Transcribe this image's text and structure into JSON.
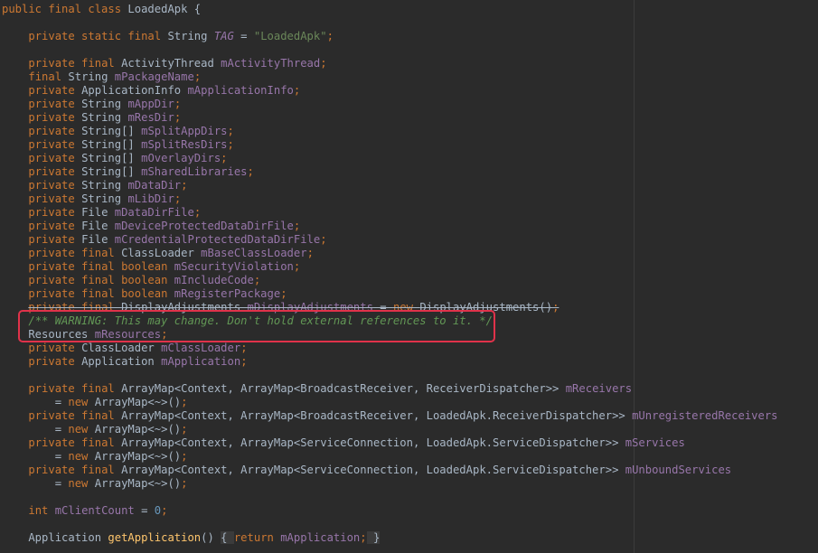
{
  "editor": {
    "lines": [
      [
        [
          "kw",
          "public final class "
        ],
        [
          "p",
          "LoadedApk {"
        ]
      ],
      [
        [
          "p",
          ""
        ]
      ],
      [
        [
          "p",
          "    "
        ],
        [
          "kw",
          "private static final "
        ],
        [
          "p",
          "String "
        ],
        [
          "const",
          "TAG"
        ],
        [
          "p",
          " = "
        ],
        [
          "str",
          "\"LoadedApk\""
        ],
        [
          "kw",
          ";"
        ]
      ],
      [
        [
          "p",
          ""
        ]
      ],
      [
        [
          "p",
          "    "
        ],
        [
          "kw",
          "private final "
        ],
        [
          "p",
          "ActivityThread "
        ],
        [
          "field",
          "mActivityThread"
        ],
        [
          "kw",
          ";"
        ]
      ],
      [
        [
          "p",
          "    "
        ],
        [
          "kw",
          "final "
        ],
        [
          "p",
          "String "
        ],
        [
          "field",
          "mPackageName"
        ],
        [
          "kw",
          ";"
        ]
      ],
      [
        [
          "p",
          "    "
        ],
        [
          "kw",
          "private "
        ],
        [
          "p",
          "ApplicationInfo "
        ],
        [
          "field",
          "mApplicationInfo"
        ],
        [
          "kw",
          ";"
        ]
      ],
      [
        [
          "p",
          "    "
        ],
        [
          "kw",
          "private "
        ],
        [
          "p",
          "String "
        ],
        [
          "field",
          "mAppDir"
        ],
        [
          "kw",
          ";"
        ]
      ],
      [
        [
          "p",
          "    "
        ],
        [
          "kw",
          "private "
        ],
        [
          "p",
          "String "
        ],
        [
          "field",
          "mResDir"
        ],
        [
          "kw",
          ";"
        ]
      ],
      [
        [
          "p",
          "    "
        ],
        [
          "kw",
          "private "
        ],
        [
          "p",
          "String[] "
        ],
        [
          "field",
          "mSplitAppDirs"
        ],
        [
          "kw",
          ";"
        ]
      ],
      [
        [
          "p",
          "    "
        ],
        [
          "kw",
          "private "
        ],
        [
          "p",
          "String[] "
        ],
        [
          "field",
          "mSplitResDirs"
        ],
        [
          "kw",
          ";"
        ]
      ],
      [
        [
          "p",
          "    "
        ],
        [
          "kw",
          "private "
        ],
        [
          "p",
          "String[] "
        ],
        [
          "field",
          "mOverlayDirs"
        ],
        [
          "kw",
          ";"
        ]
      ],
      [
        [
          "p",
          "    "
        ],
        [
          "kw",
          "private "
        ],
        [
          "p",
          "String[] "
        ],
        [
          "field",
          "mSharedLibraries"
        ],
        [
          "kw",
          ";"
        ]
      ],
      [
        [
          "p",
          "    "
        ],
        [
          "kw",
          "private "
        ],
        [
          "p",
          "String "
        ],
        [
          "field",
          "mDataDir"
        ],
        [
          "kw",
          ";"
        ]
      ],
      [
        [
          "p",
          "    "
        ],
        [
          "kw",
          "private "
        ],
        [
          "p",
          "String "
        ],
        [
          "field",
          "mLibDir"
        ],
        [
          "kw",
          ";"
        ]
      ],
      [
        [
          "p",
          "    "
        ],
        [
          "kw",
          "private "
        ],
        [
          "p",
          "File "
        ],
        [
          "field",
          "mDataDirFile"
        ],
        [
          "kw",
          ";"
        ]
      ],
      [
        [
          "p",
          "    "
        ],
        [
          "kw",
          "private "
        ],
        [
          "p",
          "File "
        ],
        [
          "field",
          "mDeviceProtectedDataDirFile"
        ],
        [
          "kw",
          ";"
        ]
      ],
      [
        [
          "p",
          "    "
        ],
        [
          "kw",
          "private "
        ],
        [
          "p",
          "File "
        ],
        [
          "field",
          "mCredentialProtectedDataDirFile"
        ],
        [
          "kw",
          ";"
        ]
      ],
      [
        [
          "p",
          "    "
        ],
        [
          "kw",
          "private final "
        ],
        [
          "p",
          "ClassLoader "
        ],
        [
          "field",
          "mBaseClassLoader"
        ],
        [
          "kw",
          ";"
        ]
      ],
      [
        [
          "p",
          "    "
        ],
        [
          "kw",
          "private final boolean "
        ],
        [
          "field",
          "mSecurityViolation"
        ],
        [
          "kw",
          ";"
        ]
      ],
      [
        [
          "p",
          "    "
        ],
        [
          "kw",
          "private final boolean "
        ],
        [
          "field",
          "mIncludeCode"
        ],
        [
          "kw",
          ";"
        ]
      ],
      [
        [
          "p",
          "    "
        ],
        [
          "kw",
          "private final boolean "
        ],
        [
          "field",
          "mRegisterPackage"
        ],
        [
          "kw",
          ";"
        ]
      ],
      [
        [
          "p",
          "    "
        ],
        [
          "kw",
          "private final "
        ],
        [
          "p",
          "DisplayAdjustments "
        ],
        [
          "field",
          "mDisplayAdjustments"
        ],
        [
          "p",
          " = "
        ],
        [
          "kw",
          "new "
        ],
        [
          "p",
          "DisplayAdjustments()"
        ],
        [
          "kw",
          ";"
        ]
      ],
      [
        [
          "p",
          "    "
        ],
        [
          "comment",
          "/** WARNING: This may change. Don't hold external references to it. */"
        ]
      ],
      [
        [
          "p",
          "    Resources "
        ],
        [
          "field",
          "mResources"
        ],
        [
          "kw",
          ";"
        ]
      ],
      [
        [
          "p",
          "    "
        ],
        [
          "kw",
          "private "
        ],
        [
          "p",
          "ClassLoader "
        ],
        [
          "field",
          "mClassLoader"
        ],
        [
          "kw",
          ";"
        ]
      ],
      [
        [
          "p",
          "    "
        ],
        [
          "kw",
          "private "
        ],
        [
          "p",
          "Application "
        ],
        [
          "field",
          "mApplication"
        ],
        [
          "kw",
          ";"
        ]
      ],
      [
        [
          "p",
          ""
        ]
      ],
      [
        [
          "p",
          "    "
        ],
        [
          "kw",
          "private final "
        ],
        [
          "p",
          "ArrayMap<Context, ArrayMap<BroadcastReceiver, ReceiverDispatcher>> "
        ],
        [
          "field",
          "mReceivers"
        ]
      ],
      [
        [
          "p",
          "        = "
        ],
        [
          "kw",
          "new "
        ],
        [
          "p",
          "ArrayMap<~>()"
        ],
        [
          "kw",
          ";"
        ]
      ],
      [
        [
          "p",
          "    "
        ],
        [
          "kw",
          "private final "
        ],
        [
          "p",
          "ArrayMap<Context, ArrayMap<BroadcastReceiver, LoadedApk.ReceiverDispatcher>> "
        ],
        [
          "field",
          "mUnregisteredReceivers"
        ]
      ],
      [
        [
          "p",
          "        = "
        ],
        [
          "kw",
          "new "
        ],
        [
          "p",
          "ArrayMap<~>()"
        ],
        [
          "kw",
          ";"
        ]
      ],
      [
        [
          "p",
          "    "
        ],
        [
          "kw",
          "private final "
        ],
        [
          "p",
          "ArrayMap<Context, ArrayMap<ServiceConnection, LoadedApk.ServiceDispatcher>> "
        ],
        [
          "field",
          "mServices"
        ]
      ],
      [
        [
          "p",
          "        = "
        ],
        [
          "kw",
          "new "
        ],
        [
          "p",
          "ArrayMap<~>()"
        ],
        [
          "kw",
          ";"
        ]
      ],
      [
        [
          "p",
          "    "
        ],
        [
          "kw",
          "private final "
        ],
        [
          "p",
          "ArrayMap<Context, ArrayMap<ServiceConnection, LoadedApk.ServiceDispatcher>> "
        ],
        [
          "field",
          "mUnboundServices"
        ]
      ],
      [
        [
          "p",
          "        = "
        ],
        [
          "kw",
          "new "
        ],
        [
          "p",
          "ArrayMap<~>()"
        ],
        [
          "kw",
          ";"
        ]
      ],
      [
        [
          "p",
          ""
        ]
      ],
      [
        [
          "p",
          "    "
        ],
        [
          "kw",
          "int "
        ],
        [
          "field",
          "mClientCount"
        ],
        [
          "p",
          " = "
        ],
        [
          "num",
          "0"
        ],
        [
          "kw",
          ";"
        ]
      ],
      [
        [
          "p",
          ""
        ]
      ],
      [
        [
          "p",
          "    Application "
        ],
        [
          "method",
          "getApplication"
        ],
        [
          "p",
          "() "
        ],
        [
          "fold",
          "{ "
        ],
        [
          "kw",
          "return "
        ],
        [
          "field",
          "mApplication"
        ],
        [
          "kw",
          ";"
        ],
        [
          "fold",
          " }"
        ]
      ]
    ],
    "strike_line": 22,
    "highlight_color": "#e0324a"
  }
}
